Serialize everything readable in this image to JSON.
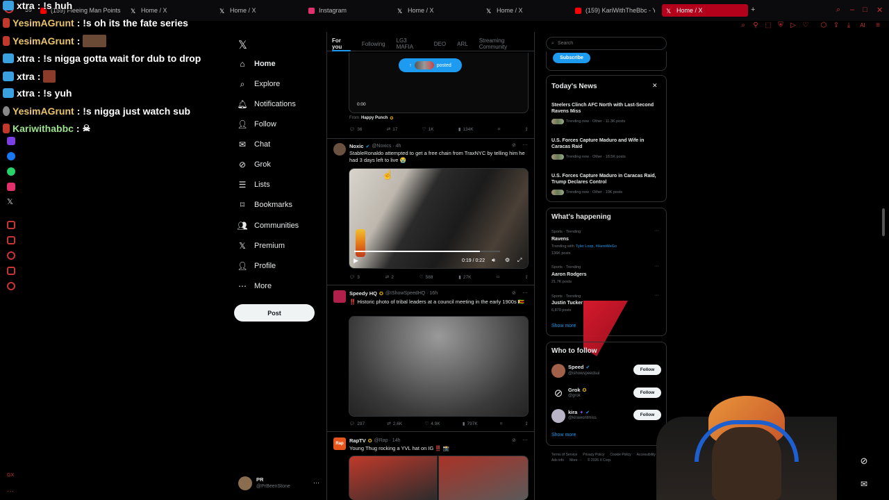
{
  "browser": {
    "tabs": [
      {
        "label": "(159) Fleeing Man Points G",
        "fav": "#ff0000"
      },
      {
        "label": "Home / X",
        "fav": "#ffffff"
      },
      {
        "label": "Home / X",
        "fav": "#ffffff"
      },
      {
        "label": "Instagram",
        "fav": "#e1306c"
      },
      {
        "label": "Home / X",
        "fav": "#ffffff"
      },
      {
        "label": "Home / X",
        "fav": "#ffffff"
      },
      {
        "label": "(159) KariWithTheBbc - Yo",
        "fav": "#ff0000"
      },
      {
        "label": "Home / X",
        "fav": "#ffffff"
      }
    ],
    "first_tab_badge": "59",
    "ai_label": "AI"
  },
  "chat": [
    {
      "user": "xtra",
      "text": ": !s huh"
    },
    {
      "user": "YesimAGrunt",
      "text": ": !s oh its the fate series"
    },
    {
      "user": "YesimAGrunt",
      "text": ": "
    },
    {
      "user": "xtra",
      "text": ": !s nigga gotta wait for dub to drop"
    },
    {
      "user": "xtra",
      "text": ": "
    },
    {
      "user": "xtra",
      "text": ": !s yuh"
    },
    {
      "user": "YesimAGrunt",
      "text": ": !s nigga just watch sub"
    },
    {
      "user": "Kariwithabbc",
      "text": ": "
    }
  ],
  "nav": {
    "items": [
      {
        "label": "Home",
        "icon": "home-icon"
      },
      {
        "label": "Explore",
        "icon": "search-icon"
      },
      {
        "label": "Notifications",
        "icon": "bell-icon"
      },
      {
        "label": "Follow",
        "icon": "person-plus-icon"
      },
      {
        "label": "Chat",
        "icon": "mail-icon"
      },
      {
        "label": "Grok",
        "icon": "grok-icon"
      },
      {
        "label": "Lists",
        "icon": "list-icon"
      },
      {
        "label": "Bookmarks",
        "icon": "bookmark-icon"
      },
      {
        "label": "Communities",
        "icon": "people-icon"
      },
      {
        "label": "Premium",
        "icon": "x-icon"
      },
      {
        "label": "Profile",
        "icon": "person-icon"
      },
      {
        "label": "More",
        "icon": "more-circle-icon"
      }
    ],
    "post_label": "Post",
    "account_name": "PR",
    "account_handle": "@PrBeenStone"
  },
  "feed": {
    "tabs": [
      "For you",
      "Following",
      "LG3 MAFIA",
      "DEO",
      "ARL",
      "Streaming Community"
    ],
    "posted_pill": "posted",
    "video_time": "0:00",
    "from_label": "From",
    "from_name": "Happy Punch",
    "top_actions": {
      "reply": "36",
      "repost": "17",
      "like": "1K",
      "views": "134K"
    },
    "posts": [
      {
        "name": "Noxic",
        "handle": "@Noxics · 4h",
        "text": "StableRonaldo attempted to get a free chain from TraxNYC by telling him he had 3 days left to live 😭",
        "player_time": "0:19 / 0:22",
        "actions": {
          "reply": "3",
          "repost": "2",
          "like": "588",
          "views": "27K"
        }
      },
      {
        "name": "Speedy HQ",
        "handle": "@IShowSpeedHQ · 16h",
        "text": "‼️ Historic photo of tribal leaders at a council meeting in the early 1900s 🇿🇼",
        "actions": {
          "reply": "297",
          "repost": "2.6K",
          "like": "4.9K",
          "views": "797K"
        }
      },
      {
        "name": "RapTV",
        "handle": "@Rap · 14h",
        "text": "Young Thug rocking a YVL hat on IG ‼️ 📸"
      }
    ]
  },
  "right": {
    "search_placeholder": "Search",
    "subscribe_label": "Subscribe",
    "news_title": "Today's News",
    "news": [
      {
        "headline": "Steelers Clinch AFC North with Last-Second Ravens Miss",
        "meta": "Trending now · Other · 11.3K posts"
      },
      {
        "headline": "U.S. Forces Capture Maduro and Wife in Caracas Raid",
        "meta": "Trending now · Other · 18.5K posts"
      },
      {
        "headline": "U.S. Forces Capture Maduro in Caracas Raid, Trump Declares Control",
        "meta": "Trending now · Other · 19K posts"
      }
    ],
    "happening_title": "What's happening",
    "trends": [
      {
        "context": "Sports · Trending",
        "name": "Ravens",
        "extra_prefix": "Trending with",
        "extra_tags": "Tyler Loop, #HereWeGo",
        "count": "136K posts"
      },
      {
        "context": "Sports · Trending",
        "name": "Aaron Rodgers",
        "count": "21.7K posts"
      },
      {
        "context": "Sports · Trending",
        "name": "Justin Tucker",
        "count": "6,879 posts"
      }
    ],
    "show_more": "Show more",
    "who_title": "Who to follow",
    "who": [
      {
        "name": "Speed",
        "handle": "@ishowspeedsui",
        "follow": "Follow"
      },
      {
        "name": "Grok",
        "handle": "@grok",
        "follow": "Follow"
      },
      {
        "name": "kira",
        "handle": "@kirawontmiss",
        "follow": "Follow"
      }
    ],
    "show_more_2": "Show more",
    "footer": [
      "Terms of Service",
      "Privacy Policy",
      "Cookie Policy",
      "Accessibility",
      "Ads info",
      "More ···",
      "© 2026 X Corp."
    ]
  },
  "colors": {
    "accent": "#1d9bf0",
    "bg": "#000000",
    "brand_red": "#b3001b"
  }
}
